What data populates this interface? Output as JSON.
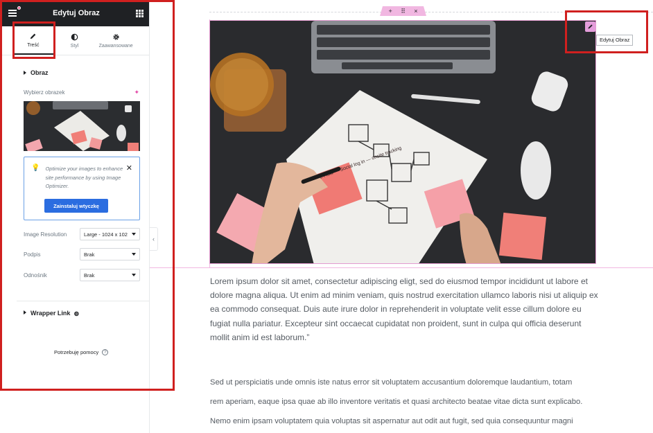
{
  "panel": {
    "title": "Edytuj Obraz",
    "tabs": [
      {
        "label": "Treść",
        "icon": "pencil-icon",
        "active": true
      },
      {
        "label": "Styl",
        "icon": "half-circle-icon",
        "active": false
      },
      {
        "label": "Zaawansowane",
        "icon": "gear-icon",
        "active": false
      }
    ],
    "image_section": {
      "title": "Obraz",
      "choose_image_label": "Wybierz obrazek",
      "optimizer_notice": {
        "text": "Optimize your images to enhance site performance by using Image Optimizer.",
        "button_label": "Zainstaluj wtyczkę"
      },
      "fields": [
        {
          "label": "Image Resolution",
          "value": "Large - 1024 x 102"
        },
        {
          "label": "Podpis",
          "value": "Brak"
        },
        {
          "label": "Odnośnik",
          "value": "Brak"
        }
      ]
    },
    "wrapper_section": {
      "title": "Wrapper Link"
    },
    "help_label": "Potrzebuję pomocy"
  },
  "canvas": {
    "section_handle": {
      "add": "+",
      "move": "⠿",
      "close": "×"
    },
    "edit_tooltip": "Edytuj Obraz",
    "paragraph1": "Lorem ipsum dolor sit amet, consectetur adipiscing eligt, sed do eiusmod tempor incididunt ut labore et dolore magna aliqua. Ut enim ad minim veniam, quis nostrud exercitation ullamco laboris nisi ut aliquip ex ea commodo consequat. Duis aute irure dolor in reprehenderit in voluptate velit esse cillum dolore eu fugiat nulla pariatur. Excepteur sint occaecat cupidatat non proident, sunt in culpa qui officia deserunt mollit anim id est laborum.”",
    "paragraph2_lines": [
      "Sed ut perspiciatis unde omnis iste natus error sit voluptatem accusantium doloremque laudantium, totam",
      "rem aperiam, eaque ipsa quae ab illo inventore veritatis et quasi architecto beatae vitae dicta sunt explicabo.",
      "Nemo enim ipsam voluptatem quia voluptas sit aspernatur aut odit aut fugit, sed quia consequuntur magni"
    ],
    "image_sticky_note": "Quite Flow — Social log in — onsite tracking"
  },
  "colors": {
    "accent_pink": "#e49ddb",
    "highlight_red": "#d0201f",
    "button_blue": "#2b6de0",
    "header_dark": "#1f2124"
  }
}
